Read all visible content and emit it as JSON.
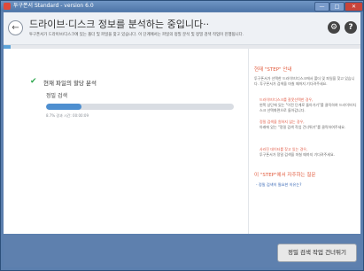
{
  "window": {
    "title": "투구폰서 Standard - version 6.0",
    "buttons": {
      "minimize": "—",
      "maximize": "□",
      "close": "✕"
    }
  },
  "header": {
    "back_icon": "←",
    "title": "드라이브·디스크 정보를 분석하는 중입니다··",
    "subtitle": "투구폰서가 드라이브/디스크에 있는 폴더 및 파일을 찾고 있습니다. 이 단계에서는 파일의 정밀 분석 및 정밀 검색 작업이 진행됩니다.",
    "settings_icon": "⚙",
    "help_icon": "?"
  },
  "progress": {
    "overall_fraction": 0.02
  },
  "main": {
    "check_icon": "✔",
    "step_title": "현재 파일의 할당 분석",
    "step_sub": "정밀 검색",
    "scan_fraction": 0.19,
    "scan_status": "8.7%  경과 시간: 00:00:09"
  },
  "sidebar": {
    "heading": "현재 \"STEP\" 안내",
    "intro": "투구폰서가 선택한 드라이브/디스크에서 폴더 및 파일을 찾고 있습니다. 투구폰서가 검색을 마칠 때까지 기다려주세요.",
    "item1_red": "드라이브/디스크를 잘못선택한 경우,",
    "item1_gray": "왼쪽 상단에 있는 \"이전 단계로 돌아가기\"를 클릭하여 드라이브/디스크 선택화면으로 돌아갑니다.",
    "item2_red": "정밀 검색을 원하지 않는 경우,",
    "item2_gray": "아래에 있는 \"정밀 검색 작업 건너뛰기\"를 클릭하여주세요.",
    "item3_red": "사라진 데이터를 찾고 있는 경우,",
    "item3_gray": "투구폰서가 정밀 검색을 마칠 때까지 기다려주세요.",
    "faq_heading": "이 \"STEP\"에서 자주하는 질문",
    "faq_link": "- 정밀 검색이 필요한 이유는?"
  },
  "footer": {
    "skip_button": "정밀 검색 작업 건너뛰기"
  },
  "colors": {
    "accent": "#5e80ae",
    "highlight": "#e15a3c",
    "progress": "#4e8fd0"
  }
}
